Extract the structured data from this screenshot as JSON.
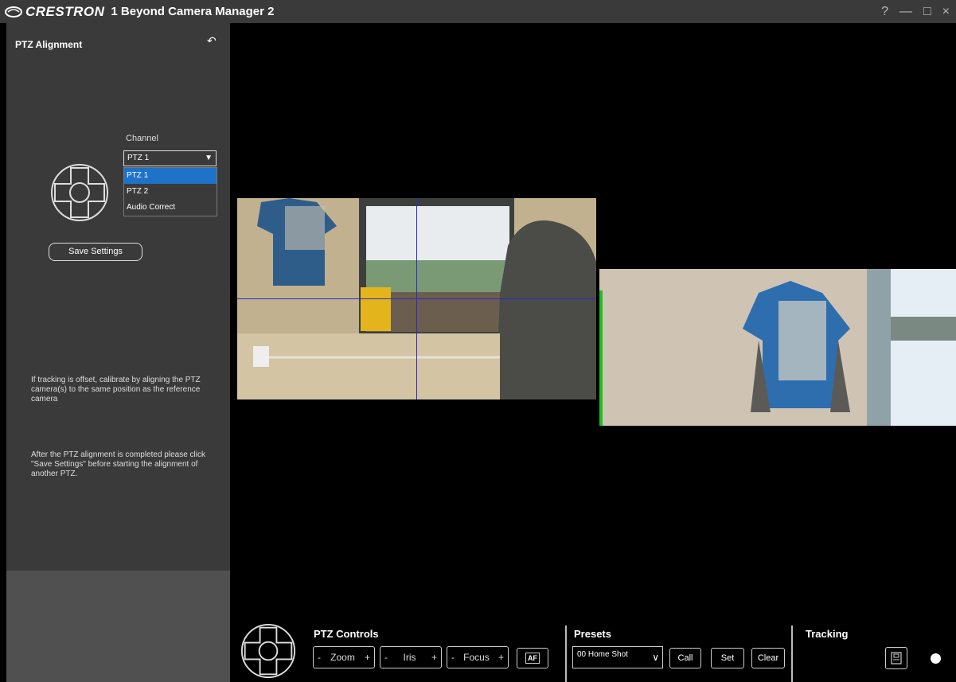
{
  "titlebar": {
    "brand": "CRESTRON",
    "app_title": "1 Beyond Camera Manager 2",
    "help": "?",
    "minimize": "—",
    "maximize": "□",
    "close": "×"
  },
  "left_panel": {
    "title": "PTZ Alignment",
    "back_icon": "↶",
    "channel_label": "Channel",
    "channel_selected": "PTZ 1",
    "channel_options": [
      "PTZ 1",
      "PTZ 2",
      "Audio Correct"
    ],
    "save_button": "Save Settings",
    "info_offset": "If tracking is offset, calibrate by aligning the PTZ camera(s) to the same position as the reference camera",
    "info_after": "After the PTZ alignment is completed please click \"Save Settings\" before starting the alignment of another PTZ."
  },
  "ptz_controls": {
    "title": "PTZ Controls",
    "zoom": {
      "minus": "-",
      "label": "Zoom",
      "plus": "+"
    },
    "iris": {
      "minus": "-",
      "label": "Iris",
      "plus": "+"
    },
    "focus": {
      "minus": "-",
      "label": "Focus",
      "plus": "+"
    },
    "af_label": "AF"
  },
  "presets": {
    "title": "Presets",
    "selected": "00 Home Shot",
    "call": "Call",
    "set": "Set",
    "clear": "Clear"
  },
  "tracking": {
    "title": "Tracking"
  },
  "colors": {
    "selected_item": "#1e73c9",
    "crosshair": "#2b2bd0",
    "alignment_marker": "#19c21f"
  }
}
